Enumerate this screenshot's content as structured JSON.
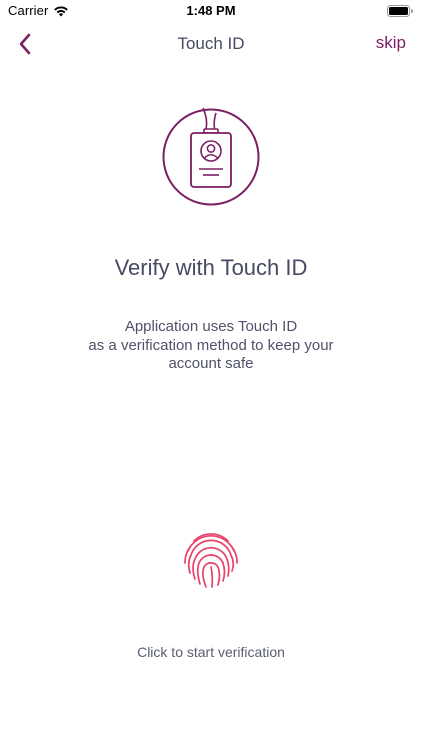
{
  "status_bar": {
    "carrier": "Carrier",
    "time": "1:48 PM",
    "wifi_icon": "wifi-icon",
    "battery_icon": "battery-icon"
  },
  "nav": {
    "title": "Touch ID",
    "skip_label": "skip",
    "back_icon": "chevron-left-icon"
  },
  "main": {
    "illustration_icon": "id-badge-icon",
    "heading": "Verify with Touch ID",
    "description_lines": [
      "Application uses Touch ID",
      "as a verification method to keep your",
      "account safe"
    ],
    "fingerprint_icon": "fingerprint-icon",
    "cta": "Click to start verification"
  },
  "colors": {
    "accent": "#7a1f63",
    "fingerprint": "#e8416a",
    "text": "#474a63",
    "background": "#ffffff"
  }
}
